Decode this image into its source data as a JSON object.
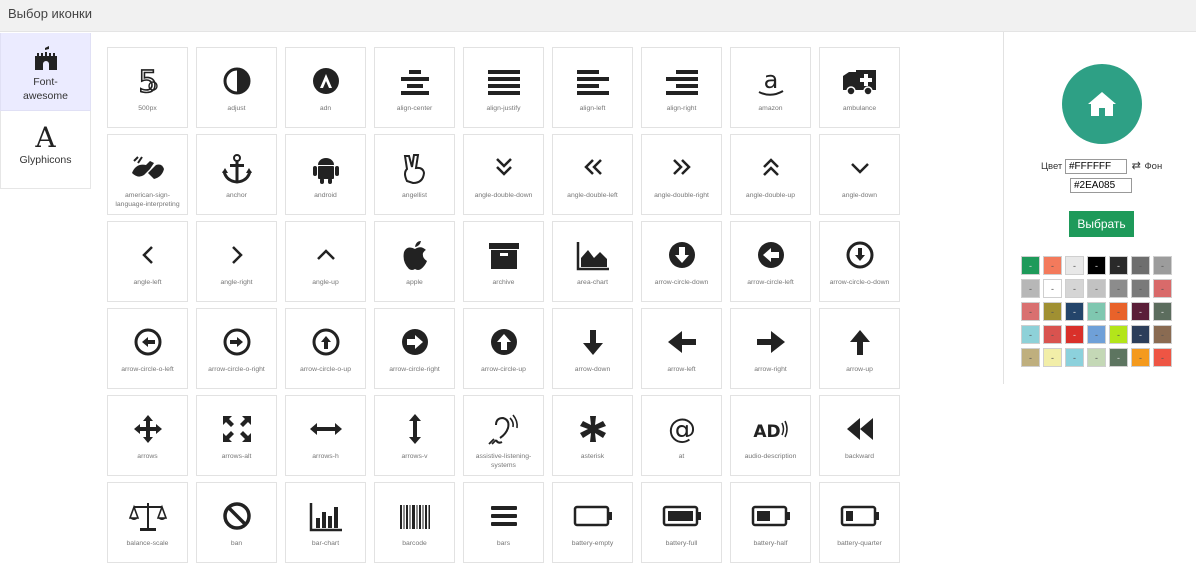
{
  "title": "Выбор иконки",
  "tabs": [
    {
      "label": "Font-awesome",
      "icon": "castle-icon",
      "active": true
    },
    {
      "label": "Glyphicons",
      "icon_glyph": "A",
      "active": false
    }
  ],
  "icons": [
    {
      "name": "500px",
      "icon": "500px-icon"
    },
    {
      "name": "adjust",
      "icon": "adjust-icon"
    },
    {
      "name": "adn",
      "icon": "adn-icon"
    },
    {
      "name": "align-center",
      "icon": "align-center-icon"
    },
    {
      "name": "align-justify",
      "icon": "align-justify-icon"
    },
    {
      "name": "align-left",
      "icon": "align-left-icon"
    },
    {
      "name": "align-right",
      "icon": "align-right-icon"
    },
    {
      "name": "amazon",
      "icon": "amazon-icon"
    },
    {
      "name": "ambulance",
      "icon": "ambulance-icon"
    },
    {
      "name": "american-sign-language-interpreting",
      "icon": "sign-language-icon"
    },
    {
      "name": "anchor",
      "icon": "anchor-icon"
    },
    {
      "name": "android",
      "icon": "android-icon"
    },
    {
      "name": "angellist",
      "icon": "angellist-icon"
    },
    {
      "name": "angle-double-down",
      "icon": "angle-double-down-icon"
    },
    {
      "name": "angle-double-left",
      "icon": "angle-double-left-icon"
    },
    {
      "name": "angle-double-right",
      "icon": "angle-double-right-icon"
    },
    {
      "name": "angle-double-up",
      "icon": "angle-double-up-icon"
    },
    {
      "name": "angle-down",
      "icon": "angle-down-icon"
    },
    {
      "name": "angle-left",
      "icon": "angle-left-icon"
    },
    {
      "name": "angle-right",
      "icon": "angle-right-icon"
    },
    {
      "name": "angle-up",
      "icon": "angle-up-icon"
    },
    {
      "name": "apple",
      "icon": "apple-icon"
    },
    {
      "name": "archive",
      "icon": "archive-icon"
    },
    {
      "name": "area-chart",
      "icon": "area-chart-icon"
    },
    {
      "name": "arrow-circle-down",
      "icon": "arrow-circle-down-icon"
    },
    {
      "name": "arrow-circle-left",
      "icon": "arrow-circle-left-icon"
    },
    {
      "name": "arrow-circle-o-down",
      "icon": "arrow-circle-o-down-icon"
    },
    {
      "name": "arrow-circle-o-left",
      "icon": "arrow-circle-o-left-icon"
    },
    {
      "name": "arrow-circle-o-right",
      "icon": "arrow-circle-o-right-icon"
    },
    {
      "name": "arrow-circle-o-up",
      "icon": "arrow-circle-o-up-icon"
    },
    {
      "name": "arrow-circle-right",
      "icon": "arrow-circle-right-icon"
    },
    {
      "name": "arrow-circle-up",
      "icon": "arrow-circle-up-icon"
    },
    {
      "name": "arrow-down",
      "icon": "arrow-down-icon"
    },
    {
      "name": "arrow-left",
      "icon": "arrow-left-icon"
    },
    {
      "name": "arrow-right",
      "icon": "arrow-right-icon"
    },
    {
      "name": "arrow-up",
      "icon": "arrow-up-icon"
    },
    {
      "name": "arrows",
      "icon": "arrows-icon"
    },
    {
      "name": "arrows-alt",
      "icon": "arrows-alt-icon"
    },
    {
      "name": "arrows-h",
      "icon": "arrows-h-icon"
    },
    {
      "name": "arrows-v",
      "icon": "arrows-v-icon"
    },
    {
      "name": "assistive-listening-systems",
      "icon": "assistive-listening-icon"
    },
    {
      "name": "asterisk",
      "icon": "asterisk-icon"
    },
    {
      "name": "at",
      "icon": "at-icon"
    },
    {
      "name": "audio-description",
      "icon": "audio-description-icon"
    },
    {
      "name": "backward",
      "icon": "backward-icon"
    },
    {
      "name": "balance-scale",
      "icon": "balance-scale-icon"
    },
    {
      "name": "ban",
      "icon": "ban-icon"
    },
    {
      "name": "bar-chart",
      "icon": "bar-chart-icon"
    },
    {
      "name": "barcode",
      "icon": "barcode-icon"
    },
    {
      "name": "bars",
      "icon": "bars-icon"
    },
    {
      "name": "battery-empty",
      "icon": "battery-empty-icon"
    },
    {
      "name": "battery-full",
      "icon": "battery-full-icon"
    },
    {
      "name": "battery-half",
      "icon": "battery-half-icon"
    },
    {
      "name": "battery-quarter",
      "icon": "battery-quarter-icon"
    }
  ],
  "preview": {
    "icon": "home-icon",
    "icon_color": "#FFFFFF",
    "background_color": "#2EA085"
  },
  "controls": {
    "color_label": "Цвет",
    "color_value": "#FFFFFF",
    "swap_symbol": "⇄",
    "background_label": "Фон",
    "background_value": "#2EA085",
    "choose_label": "Выбрать",
    "choose_color": "#1E9A5A"
  },
  "palette": [
    {
      "color": "#1E9A5A",
      "label": "-"
    },
    {
      "color": "#F37A5C",
      "label": "-"
    },
    {
      "color": "#E8E8E8",
      "label": "-"
    },
    {
      "color": "#000000",
      "label": "-"
    },
    {
      "color": "#2A2A2A",
      "label": "-"
    },
    {
      "color": "#6E6E6E",
      "label": "-"
    },
    {
      "color": "#9C9C9C",
      "label": "-"
    },
    {
      "color": "#B7B7B7",
      "label": "-"
    },
    {
      "color": "#FFFFFF",
      "label": "-"
    },
    {
      "color": "#D5D5D5",
      "label": "-"
    },
    {
      "color": "#C2C2C2",
      "label": "-"
    },
    {
      "color": "#8C8C8C",
      "label": "-"
    },
    {
      "color": "#7A7A7A",
      "label": "-"
    },
    {
      "color": "#D96A6A",
      "label": "-"
    },
    {
      "color": "#D97070",
      "label": "-"
    },
    {
      "color": "#A09032",
      "label": "-"
    },
    {
      "color": "#24456B",
      "label": "-"
    },
    {
      "color": "#7FC7B0",
      "label": "-"
    },
    {
      "color": "#E8622A",
      "label": "-"
    },
    {
      "color": "#5A1E38",
      "label": "-"
    },
    {
      "color": "#5C6D5E",
      "label": "-"
    },
    {
      "color": "#8ED1D8",
      "label": "-"
    },
    {
      "color": "#D9534F",
      "label": "-"
    },
    {
      "color": "#D9302A",
      "label": "-"
    },
    {
      "color": "#6FA0D8",
      "label": "-"
    },
    {
      "color": "#B3E51A",
      "label": "-"
    },
    {
      "color": "#2C3E5A",
      "label": "-"
    },
    {
      "color": "#8A6B52",
      "label": "-"
    },
    {
      "color": "#BFAF7E",
      "label": "-"
    },
    {
      "color": "#F2EEA8",
      "label": "-"
    },
    {
      "color": "#8CD1DC",
      "label": "-"
    },
    {
      "color": "#C4D8B6",
      "label": "-"
    },
    {
      "color": "#5D7560",
      "label": "-"
    },
    {
      "color": "#F49A1E",
      "label": "-"
    },
    {
      "color": "#EE5544",
      "label": "-"
    }
  ]
}
